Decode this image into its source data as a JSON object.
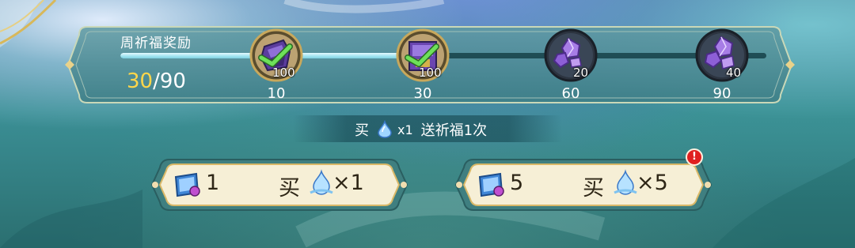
{
  "reward_panel": {
    "title": "周祈福奖励",
    "progress": {
      "current": "30",
      "separator": "/",
      "max": "90",
      "fill_fraction": 0.44
    },
    "milestones": [
      {
        "threshold": "10",
        "quantity": "100",
        "icon": "crystal-chest-icon",
        "claimed": true
      },
      {
        "threshold": "30",
        "quantity": "100",
        "icon": "crystal-chest-icon",
        "claimed": true
      },
      {
        "threshold": "60",
        "quantity": "20",
        "icon": "purple-crystal-icon",
        "claimed": false
      },
      {
        "threshold": "90",
        "quantity": "40",
        "icon": "purple-crystal-icon",
        "claimed": false
      }
    ]
  },
  "info": {
    "buy": "买",
    "icon": "blessing-drop-icon",
    "multiplier": "x1",
    "gift": "送祈福1次"
  },
  "buttons": [
    {
      "cost": "1",
      "buy": "买",
      "quantity": "×1",
      "icon": "blessing-ticket-icon",
      "alert": false
    },
    {
      "cost": "5",
      "buy": "买",
      "quantity": "×5",
      "icon": "blessing-ticket-icon",
      "alert": true,
      "alert_text": "!"
    }
  ],
  "colors": {
    "progress_current": "#ffd64a",
    "button_fill": "#f6efd6",
    "button_border": "#d9b867",
    "panel_border": "#c9d8b8",
    "alert": "#e02020"
  }
}
